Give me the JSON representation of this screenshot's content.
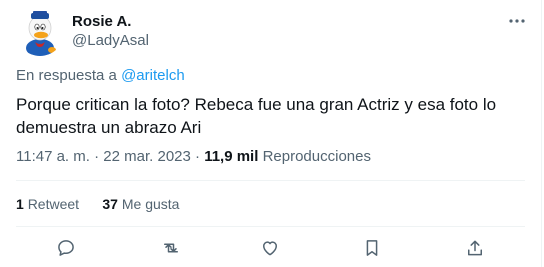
{
  "user": {
    "name": "Rosie A.",
    "handle": "@LadyAsal"
  },
  "reply": {
    "prefix": "En respuesta a",
    "mention": "@aritelch"
  },
  "tweet": {
    "text": "Porque critican la foto? Rebeca fue una gran Actriz y esa foto lo\ndemuestra un abrazo Ari",
    "time": "11:47 a. m.",
    "separator": "·",
    "date": "22 mar. 2023",
    "views_count": "11,9 mil",
    "views_label": "Reproducciones"
  },
  "stats": {
    "retweets_count": "1",
    "retweets_label": "Retweet",
    "likes_count": "37",
    "likes_label": "Me gusta"
  },
  "icons": {
    "more": "more-horizontal-icon",
    "reply": "reply-icon",
    "retweet": "retweet-icon",
    "like": "heart-icon",
    "bookmark": "bookmark-icon",
    "share": "share-icon"
  },
  "colors": {
    "text": "#0f1419",
    "secondary": "#536471",
    "link": "#1d9bf0",
    "divider": "#eff3f4"
  }
}
